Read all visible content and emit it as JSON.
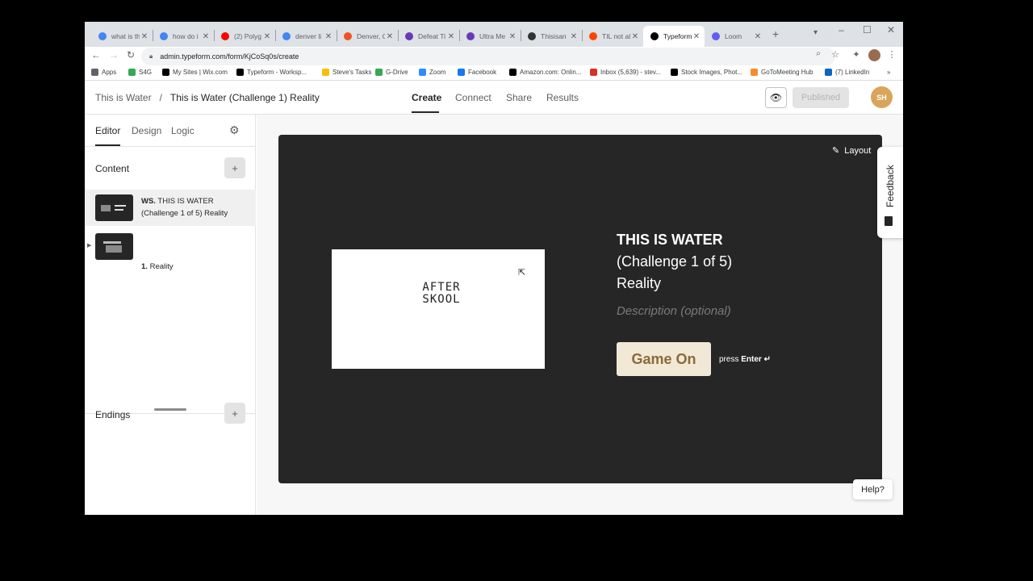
{
  "browser": {
    "tabs": [
      {
        "title": "what is th",
        "favicon": "google-icon",
        "color": "#4285f4"
      },
      {
        "title": "how do i",
        "favicon": "google-icon",
        "color": "#4285f4"
      },
      {
        "title": "(2) Polyg",
        "favicon": "youtube-icon",
        "color": "#ff0000"
      },
      {
        "title": "denver li",
        "favicon": "google-icon",
        "color": "#4285f4"
      },
      {
        "title": "Denver, C",
        "favicon": "sun-icon",
        "color": "#f4511e"
      },
      {
        "title": "Defeat Ti",
        "favicon": "form-icon",
        "color": "#673ab7"
      },
      {
        "title": "Ultra Me",
        "favicon": "form-icon",
        "color": "#673ab7"
      },
      {
        "title": "Thisisan",
        "favicon": "image-icon",
        "color": "#333333"
      },
      {
        "title": "TIL not al",
        "favicon": "reddit-icon",
        "color": "#ff4500"
      },
      {
        "title": "Typeform",
        "favicon": "typeform-icon",
        "color": "#000000"
      },
      {
        "title": "Loom",
        "favicon": "loom-icon",
        "color": "#625df5"
      }
    ],
    "url": "admin.typeform.com/form/KjCoSq0s/create",
    "bookmarks": [
      {
        "label": "Apps",
        "color": "#5f6368"
      },
      {
        "label": "S4G",
        "color": "#34a853"
      },
      {
        "label": "My Sites | Wix.com",
        "color": "#000000"
      },
      {
        "label": "Typeform - Worksp...",
        "color": "#000000"
      },
      {
        "label": "Steve's Tasks",
        "color": "#fbbc04"
      },
      {
        "label": "G-Drive",
        "color": "#34a853"
      },
      {
        "label": "Zoom",
        "color": "#2d8cff"
      },
      {
        "label": "Facebook",
        "color": "#1877f2"
      },
      {
        "label": "Amazon.com: Onlin...",
        "color": "#000000"
      },
      {
        "label": "Inbox (5,639) - stev...",
        "color": "#d93025"
      },
      {
        "label": "Stock Images, Phot...",
        "color": "#000000"
      },
      {
        "label": "GoToMeeting Hub",
        "color": "#f68d2e"
      },
      {
        "label": "(7) LinkedIn",
        "color": "#0a66c2"
      }
    ]
  },
  "header": {
    "workspace": "This is Water",
    "separator": "/",
    "form_title": "This is Water (Challenge 1) Reality",
    "nav": [
      "Create",
      "Connect",
      "Share",
      "Results"
    ],
    "published_label": "Published",
    "avatar_initials": "SH"
  },
  "sidebar": {
    "tabs": [
      "Editor",
      "Design",
      "Logic"
    ],
    "content_label": "Content",
    "items": [
      {
        "prefix": "WS.",
        "line1": "THIS IS WATER",
        "line2": "(Challenge 1 of 5) Reality"
      },
      {
        "prefix": "1.",
        "line1": "Reality"
      }
    ],
    "endings_label": "Endings"
  },
  "canvas": {
    "layout_label": "Layout",
    "media_text_line1": "AFTER",
    "media_text_line2": "SKOOL",
    "title_line1": "THIS IS WATER",
    "title_line2": "(Challenge 1 of 5)",
    "title_line3": "Reality",
    "description_placeholder": "Description (optional)",
    "button_label": "Game On",
    "press_label": "press",
    "enter_label": "Enter ↵"
  },
  "widgets": {
    "feedback_label": "Feedback",
    "help_label": "Help?"
  }
}
